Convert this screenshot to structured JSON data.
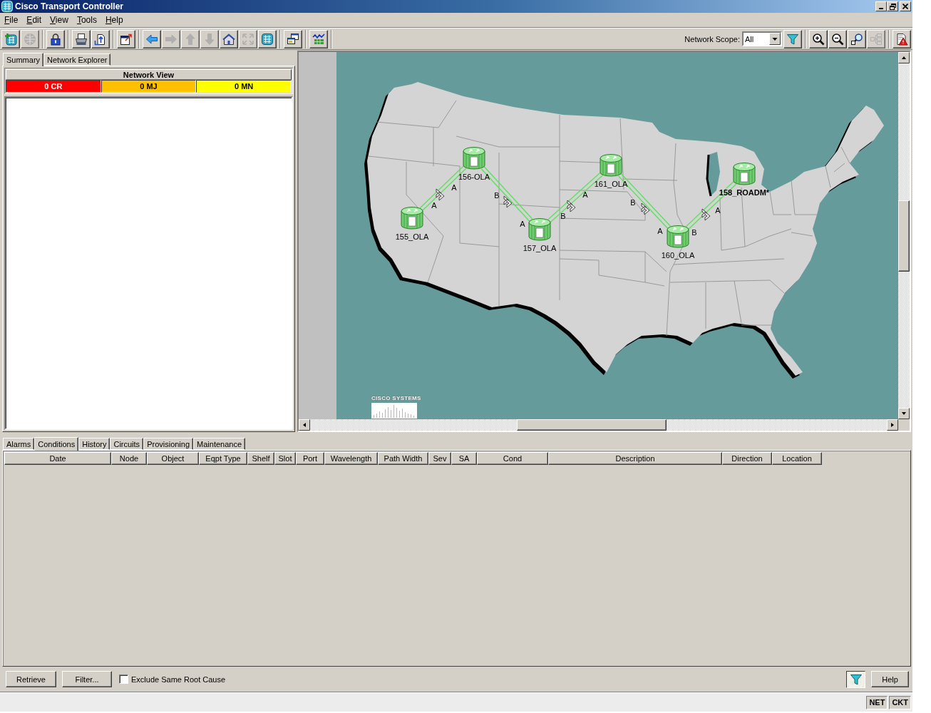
{
  "window": {
    "title": "Cisco Transport Controller"
  },
  "menu": [
    "File",
    "Edit",
    "View",
    "Tools",
    "Help"
  ],
  "toolbar": {
    "left_groups": [
      {
        "buttons": [
          {
            "kind": "network",
            "disabled": false
          },
          {
            "kind": "globe",
            "disabled": true
          }
        ]
      },
      {
        "buttons": [
          {
            "kind": "lock",
            "disabled": false
          }
        ]
      },
      {
        "buttons": [
          {
            "kind": "print",
            "disabled": false
          },
          {
            "kind": "export",
            "disabled": false
          }
        ]
      },
      {
        "buttons": [
          {
            "kind": "dialog",
            "disabled": false
          }
        ]
      },
      {
        "buttons": [
          {
            "kind": "back",
            "disabled": false
          },
          {
            "kind": "forward",
            "disabled": true
          },
          {
            "kind": "up",
            "disabled": true
          },
          {
            "kind": "down",
            "disabled": true
          },
          {
            "kind": "home",
            "disabled": false
          },
          {
            "kind": "expand",
            "disabled": true
          },
          {
            "kind": "nodes",
            "disabled": false
          }
        ]
      },
      {
        "buttons": [
          {
            "kind": "windows",
            "disabled": false
          }
        ]
      },
      {
        "buttons": [
          {
            "kind": "chart",
            "disabled": false
          }
        ]
      }
    ],
    "scope_label": "Network Scope:",
    "scope_value": "All",
    "right_groups": [
      {
        "buttons": [
          {
            "kind": "filter",
            "disabled": false
          }
        ]
      },
      {
        "buttons": [
          {
            "kind": "zoomin",
            "disabled": false
          },
          {
            "kind": "zoomout",
            "disabled": false
          },
          {
            "kind": "zoomarea",
            "disabled": false
          },
          {
            "kind": "tree",
            "disabled": true
          }
        ]
      },
      {
        "buttons": [
          {
            "kind": "alarm",
            "disabled": false
          }
        ]
      }
    ]
  },
  "left_tabs": [
    {
      "label": "Summary",
      "selected": true
    },
    {
      "label": "Network Explorer",
      "selected": false
    }
  ],
  "network_view": {
    "title": "Network View",
    "alarm_counts": [
      {
        "label": "0 CR",
        "color": "#ff0000"
      },
      {
        "label": "0 MJ",
        "color": "#ffc000"
      },
      {
        "label": "0 MN",
        "color": "#ffff00"
      }
    ]
  },
  "map": {
    "nodes": [
      {
        "name": "155_OLA",
        "highlighted": false
      },
      {
        "name": "156-OLA",
        "highlighted": false
      },
      {
        "name": "157_OLA",
        "highlighted": false
      },
      {
        "name": "161_OLA",
        "highlighted": false
      },
      {
        "name": "160_OLA",
        "highlighted": false
      },
      {
        "name": "158_ROADM*",
        "highlighted": true
      }
    ],
    "spans": [
      {
        "near_port": "A",
        "far_port": "A"
      },
      {
        "near_port": "B",
        "far_port": "A"
      },
      {
        "near_port": "B",
        "far_port": "A"
      },
      {
        "near_port": "B",
        "far_port": "A"
      },
      {
        "near_port": "B",
        "far_port": "A"
      }
    ],
    "logo_text": "CISCO SYSTEMS"
  },
  "bottom_tabs": [
    {
      "label": "Alarms",
      "selected": false
    },
    {
      "label": "Conditions",
      "selected": true
    },
    {
      "label": "History",
      "selected": false
    },
    {
      "label": "Circuits",
      "selected": false
    },
    {
      "label": "Provisioning",
      "selected": false
    },
    {
      "label": "Maintenance",
      "selected": false
    }
  ],
  "conditions_table": {
    "columns": [
      "Date",
      "Node",
      "Object",
      "Eqpt Type",
      "Shelf",
      "Slot",
      "Port",
      "Wavelength",
      "Path Width",
      "Sev",
      "SA",
      "Cond",
      "Description",
      "Direction",
      "Location"
    ]
  },
  "actions": {
    "retrieve": "Retrieve",
    "filter": "Filter...",
    "exclude_root_cause": {
      "label": "Exclude Same Root Cause",
      "checked": false
    },
    "filter_toggle": {
      "on": true
    },
    "help": "Help"
  },
  "status_bar": {
    "indicators": [
      "NET",
      "CKT"
    ]
  }
}
